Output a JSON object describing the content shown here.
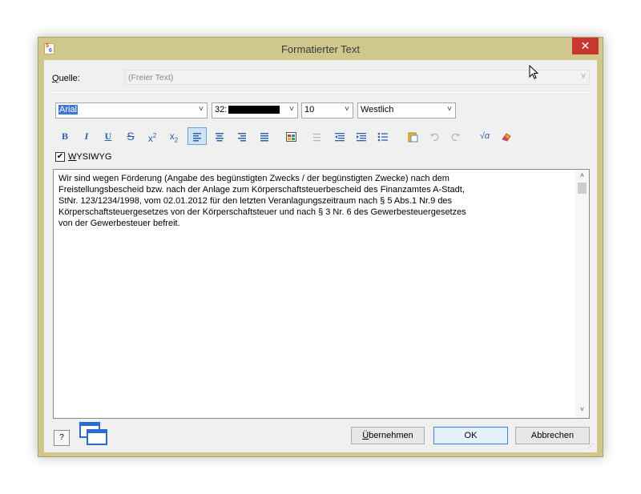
{
  "window": {
    "title": "Formatierter Text",
    "close_glyph": "✕",
    "app_icon": {
      "a": "5",
      "b": "6"
    }
  },
  "source": {
    "label_underlined": "Q",
    "label_rest": "uelle:",
    "value": "(Freier Text)"
  },
  "format_bar": {
    "font": "Arial",
    "color_prefix": "32:",
    "size": "10",
    "script": "Westlich"
  },
  "toolbar": {
    "bold": "B",
    "italic": "I",
    "underline": "U",
    "strike": "S",
    "superscript_base": "x",
    "superscript_exp": "2",
    "subscript_base": "x",
    "subscript_exp": "2",
    "sqrt": "√α"
  },
  "wysiwyg": {
    "checked_glyph": "✔",
    "label_underlined": "W",
    "label_rest": "YSIWYG"
  },
  "editor": {
    "lines": [
      "Wir sind wegen Förderung (Angabe des begünstigten Zwecks / der begünstigten Zwecke) nach dem",
      "Freistellungsbescheid bzw. nach der Anlage zum Körperschaftsteuerbescheid des Finanzamtes A-Stadt,",
      "StNr. 123/1234/1998, vom 02.01.2012 für den letzten Veranlagungszeitraum nach § 5 Abs.1 Nr.9 des",
      "Körperschaftsteuergesetzes von der Körperschaftsteuer und nach § 3 Nr. 6 des Gewerbesteuergesetzes",
      "von der Gewerbesteuer befreit."
    ],
    "scroll_up": "˄",
    "scroll_down": "˅"
  },
  "buttons": {
    "help": "?",
    "apply_underlined": "Ü",
    "apply_rest": "bernehmen",
    "ok": "OK",
    "cancel": "Abbrechen"
  },
  "colors": {
    "frame": "#cfc78c",
    "close": "#c7372f",
    "accent": "#2d5fb0"
  }
}
